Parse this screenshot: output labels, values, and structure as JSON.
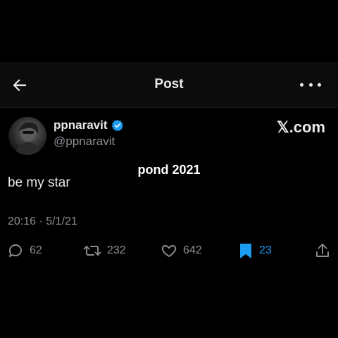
{
  "header": {
    "title": "Post",
    "back_icon": "arrow-left-icon",
    "more_icon": "more-horizontal-icon"
  },
  "author": {
    "display_name": "ppnaravit",
    "handle": "@ppnaravit",
    "verified": true,
    "verified_color": "#1d9bf0"
  },
  "watermark": "𝕏.com",
  "overlay_caption": "pond 2021",
  "post": {
    "text": "be my star",
    "timestamp": "20:16 · 5/1/21"
  },
  "actions": {
    "replies": "62",
    "reposts": "232",
    "likes": "642",
    "bookmarks": "23",
    "bookmark_active": true,
    "accent_color": "#1d9bf0"
  }
}
